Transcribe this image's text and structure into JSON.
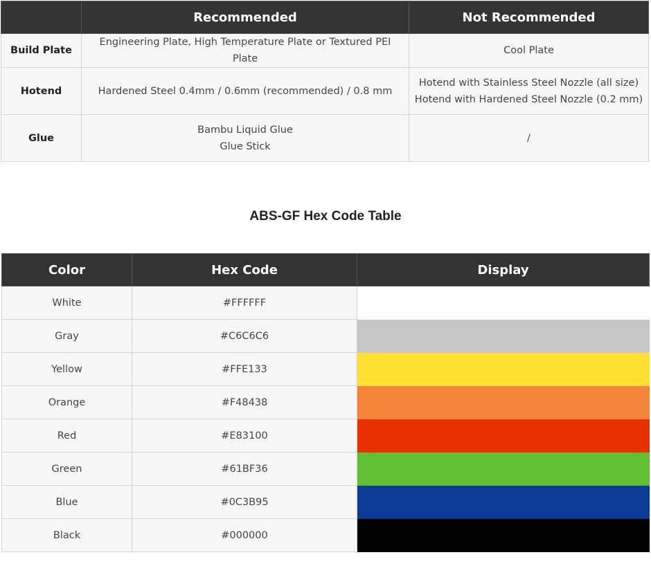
{
  "compat_table": {
    "headers": [
      "",
      "Recommended",
      "Not Recommended"
    ],
    "rows": [
      {
        "label": "Build Plate",
        "recommended": [
          "Engineering Plate, High Temperature Plate or Textured PEI Plate"
        ],
        "not_recommended": [
          "Cool Plate"
        ]
      },
      {
        "label": "Hotend",
        "recommended": [
          "Hardened Steel 0.4mm / 0.6mm (recommended) / 0.8 mm"
        ],
        "not_recommended": [
          "Hotend with Stainless Steel Nozzle (all size)",
          "Hotend with Hardened Steel Nozzle (0.2 mm)"
        ]
      },
      {
        "label": "Glue",
        "recommended": [
          "Bambu Liquid Glue",
          "Glue Stick"
        ],
        "not_recommended": [
          "/"
        ]
      }
    ]
  },
  "hex_title": "ABS-GF Hex Code Table",
  "hex_table": {
    "headers": [
      "Color",
      "Hex Code",
      "Display"
    ],
    "rows": [
      {
        "color": "White",
        "hex": "#FFFFFF"
      },
      {
        "color": "Gray",
        "hex": "#C6C6C6"
      },
      {
        "color": "Yellow",
        "hex": "#FFE133"
      },
      {
        "color": "Orange",
        "hex": "#F48438"
      },
      {
        "color": "Red",
        "hex": "#E83100"
      },
      {
        "color": "Green",
        "hex": "#61BF36"
      },
      {
        "color": "Blue",
        "hex": "#0C3B95"
      },
      {
        "color": "Black",
        "hex": "#000000"
      }
    ]
  }
}
